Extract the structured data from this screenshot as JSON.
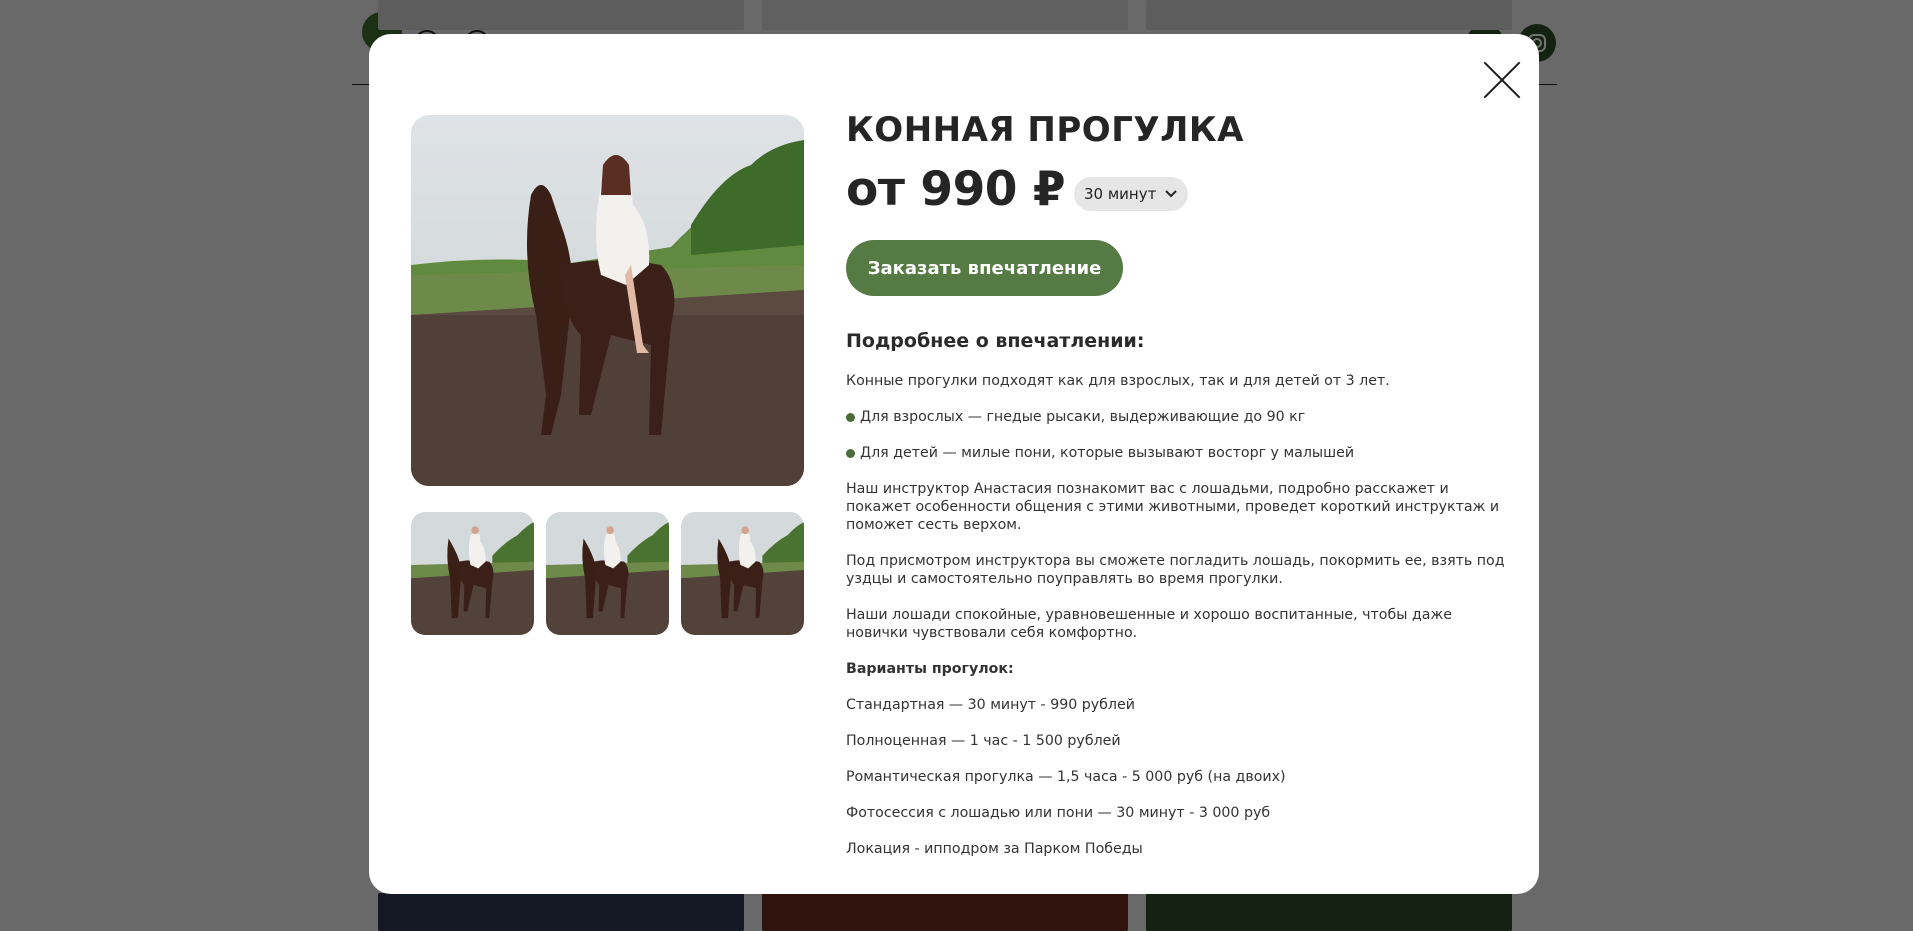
{
  "modal": {
    "title": "КОННАЯ ПРОГУЛКА",
    "price": "от 990 ₽",
    "duration_selected": "30 минут",
    "order_button": "Заказать впечатление",
    "details_heading": "Подробнее о впечатлении:",
    "intro": "Конные прогулки подходят как для взрослых, так и для детей от 3 лет.",
    "bullets": [
      "Для взрослых — гнедые рысаки, выдерживающие до 90 кг",
      "Для детей — милые пони, которые вызывают восторг у малышей"
    ],
    "paragraphs": [
      "Наш инструктор Анастасия познакомит вас с лошадьми, подробно расскажет и покажет особенности общения с этими животными, проведет короткий инструктаж и поможет сесть верхом.",
      "Под присмотром инструктора вы сможете погладить лошадь, покормить ее, взять под уздцы и самостоятельно поуправлять во время прогулки.",
      "Наши лошади спокойные, уравновешенные и хорошо воспитанные, чтобы даже новички чувствовали себя комфортно."
    ],
    "variants_title": "Варианты прогулок:",
    "variants": [
      "Стандартная — 30 минут - 990 рублей",
      "Полноценная — 1 час - 1 500 рублей",
      "Романтическая прогулка — 1,5 часа - 5 000 руб (на двоих)",
      "Фотосессия с лошадью или пони — 30 минут - 3 000 руб"
    ],
    "location": "Локация - ипподром за Парком Победы"
  },
  "colors": {
    "accent": "#557a44",
    "bullet": "#4b6b3a",
    "select_bg": "#e6e6e6"
  },
  "icons": [
    "close-icon",
    "chevron-down-icon",
    "instagram-icon",
    "logo-icon"
  ]
}
